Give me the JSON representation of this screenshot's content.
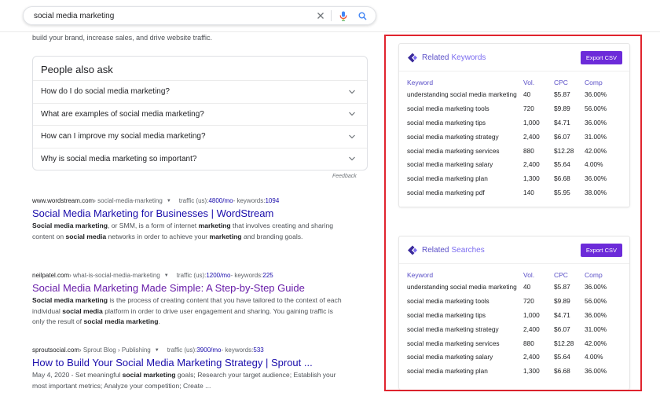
{
  "search": {
    "query": "social media marketing",
    "clear_icon": "close-icon",
    "mic_icon": "mic-icon",
    "search_icon": "search-icon"
  },
  "snippet_top": "build your brand, increase sales, and drive website traffic.",
  "paa": {
    "title": "People also ask",
    "questions": [
      "How do I do social media marketing?",
      "What are examples of social media marketing?",
      "How can I improve my social media marketing?",
      "Why is social media marketing so important?"
    ],
    "feedback": "Feedback"
  },
  "results": [
    {
      "domain": "www.wordstream.com",
      "path": " › social-media-marketing",
      "traffic_label": "traffic (us): ",
      "traffic_value": "4800/mo",
      "kw_label": " - keywords: ",
      "kw_value": "1094",
      "title": "Social Media Marketing for Businesses | WordStream",
      "desc_html": "<b>Social media marketing</b>, or SMM, is a form of internet <b>marketing</b> that involves creating and sharing content on <b>social media</b> networks in order to achieve your <b>marketing</b> and branding goals."
    },
    {
      "domain": "neilpatel.com",
      "path": " › what-is-social-media-marketing",
      "traffic_label": "traffic (us): ",
      "traffic_value": "1200/mo",
      "kw_label": " - keywords: ",
      "kw_value": "225",
      "title": "Social Media Marketing Made Simple: A Step-by-Step Guide",
      "desc_html": "<b>Social media marketing</b> is the process of creating content that you have tailored to the context of each individual <b>social media</b> platform in order to drive user engagement and sharing. You gaining traffic is only the result of <b>social media marketing</b>."
    },
    {
      "domain": "sproutsocial.com",
      "path": " › Sprout Blog › Publishing",
      "traffic_label": "traffic (us): ",
      "traffic_value": "3900/mo",
      "kw_label": " - keywords: ",
      "kw_value": "533",
      "title": "How to Build Your Social Media Marketing Strategy | Sprout ...",
      "desc_html": "May 4, 2020 - Set meaningful <b>social marketing</b> goals; Research your target audience; Establish your most important metrics; Analyze your competition; Create ..."
    }
  ],
  "panels": [
    {
      "title_part1": "Related",
      "title_part2": "Keywords",
      "export_label": "Export CSV",
      "headers": [
        "Keyword",
        "Vol.",
        "CPC",
        "Comp"
      ],
      "rows": [
        [
          "understanding social media marketing",
          "40",
          "$5.87",
          "36.00%"
        ],
        [
          "social media marketing tools",
          "720",
          "$9.89",
          "56.00%"
        ],
        [
          "social media marketing tips",
          "1,000",
          "$4.71",
          "36.00%"
        ],
        [
          "social media marketing strategy",
          "2,400",
          "$6.07",
          "31.00%"
        ],
        [
          "social media marketing services",
          "880",
          "$12.28",
          "42.00%"
        ],
        [
          "social media marketing salary",
          "2,400",
          "$5.64",
          "4.00%"
        ],
        [
          "social media marketing plan",
          "1,300",
          "$6.68",
          "36.00%"
        ],
        [
          "social media marketing pdf",
          "140",
          "$5.95",
          "38.00%"
        ]
      ]
    },
    {
      "title_part1": "Related",
      "title_part2": "Searches",
      "export_label": "Export CSV",
      "headers": [
        "Keyword",
        "Vol.",
        "CPC",
        "Comp"
      ],
      "rows": [
        [
          "understanding social media marketing",
          "40",
          "$5.87",
          "36.00%"
        ],
        [
          "social media marketing tools",
          "720",
          "$9.89",
          "56.00%"
        ],
        [
          "social media marketing tips",
          "1,000",
          "$4.71",
          "36.00%"
        ],
        [
          "social media marketing strategy",
          "2,400",
          "$6.07",
          "31.00%"
        ],
        [
          "social media marketing services",
          "880",
          "$12.28",
          "42.00%"
        ],
        [
          "social media marketing salary",
          "2,400",
          "$5.64",
          "4.00%"
        ],
        [
          "social media marketing plan",
          "1,300",
          "$6.68",
          "36.00%"
        ]
      ]
    }
  ],
  "colors": {
    "link": "#1a0dab",
    "visited": "#681da8",
    "accent": "#6c2bd9",
    "highlight": "#e0242e"
  }
}
